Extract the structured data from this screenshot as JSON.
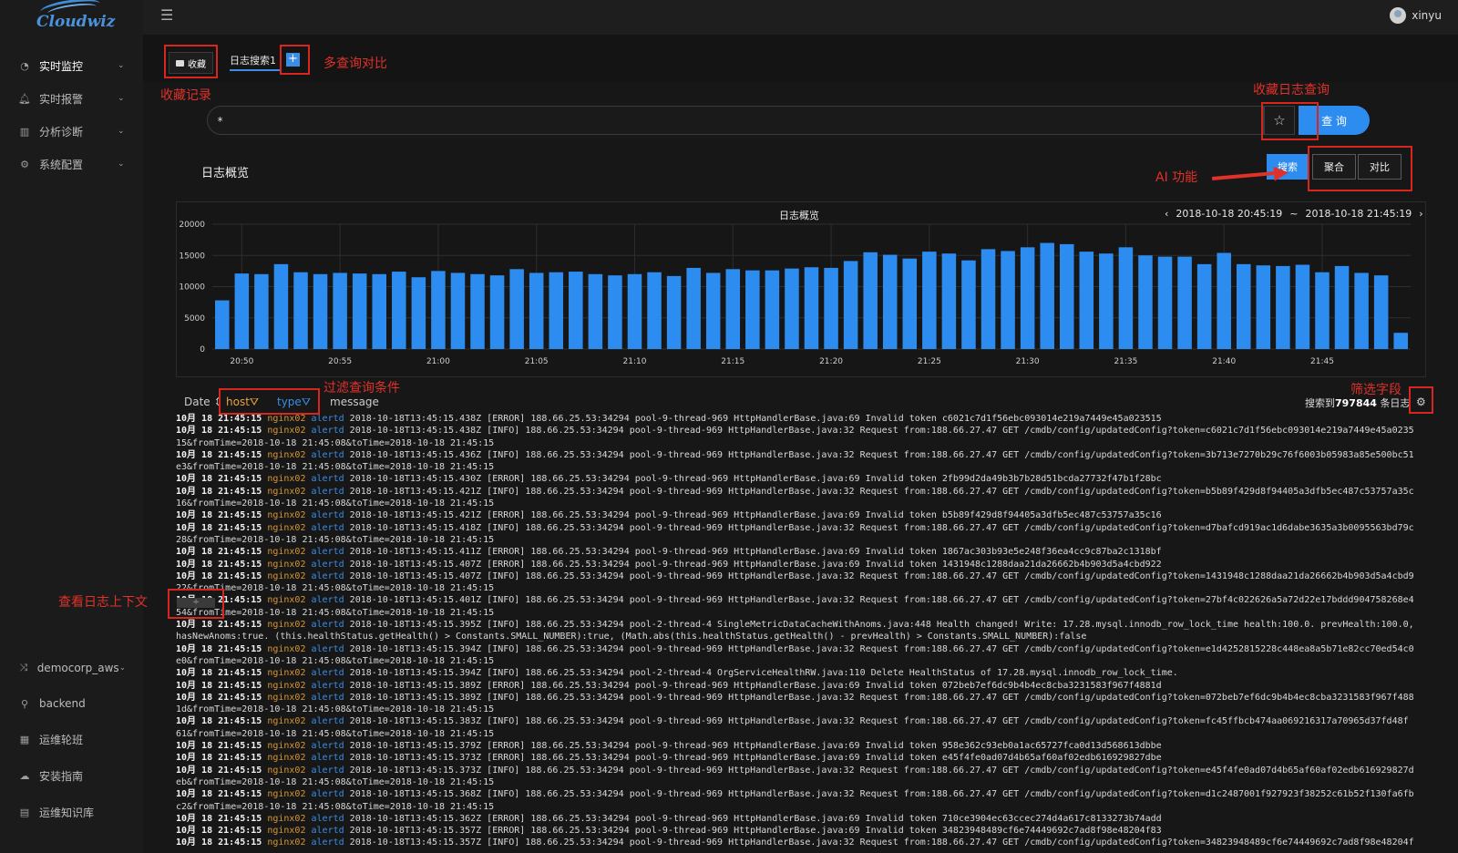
{
  "app": {
    "logo_text": "Cloudwiz",
    "username": "xinyu"
  },
  "sidebar": {
    "items": [
      {
        "label": "实时监控",
        "icon": "dashboard-icon"
      },
      {
        "label": "实时报警",
        "icon": "bell-icon"
      },
      {
        "label": "分析诊断",
        "icon": "bar-chart-icon"
      },
      {
        "label": "系统配置",
        "icon": "gears-icon"
      }
    ],
    "bottom_items": [
      {
        "label": "democorp_aws",
        "icon": "shuffle-icon"
      },
      {
        "label": "backend",
        "icon": "sitemap-icon"
      },
      {
        "label": "运维轮班",
        "icon": "calendar-icon"
      },
      {
        "label": "安装指南",
        "icon": "cloud-icon"
      },
      {
        "label": "运维知识库",
        "icon": "book-icon"
      }
    ]
  },
  "tabs": {
    "favorites_label": "收藏",
    "search_tab_label": "日志搜索1",
    "add_label": "+"
  },
  "search": {
    "value": "*",
    "star_icon": "star-icon",
    "query_label": "查 询"
  },
  "overview": {
    "title": "日志概览",
    "modes": [
      "搜索",
      "聚合",
      "对比"
    ]
  },
  "annotations": {
    "multi_query": "多查询对比",
    "favorites_record": "收藏记录",
    "save_query": "收藏日志查询",
    "ai_function": "AI 功能",
    "filter_conditions": "过滤查询条件",
    "filter_fields": "筛选字段",
    "view_context": "查看日志上下文"
  },
  "chart_data": {
    "type": "bar",
    "title": "日志概览",
    "range_start": "2018-10-18 20:45:19",
    "range_sep": "~",
    "range_end": "2018-10-18 21:45:19",
    "ylim": [
      0,
      20000
    ],
    "yticks": [
      "20000",
      "15000",
      "10000",
      "5000",
      "0"
    ],
    "xticks": [
      "20:50",
      "20:55",
      "21:00",
      "21:05",
      "21:10",
      "21:15",
      "21:20",
      "21:25",
      "21:30",
      "21:35",
      "21:40",
      "21:45"
    ],
    "bar_color": "#2d8cf0",
    "values": [
      7800,
      12100,
      12000,
      13600,
      12300,
      12000,
      12200,
      12100,
      12000,
      12400,
      11500,
      12500,
      12200,
      12000,
      11800,
      12800,
      12200,
      12300,
      12400,
      12000,
      11800,
      12000,
      12300,
      11700,
      13000,
      12200,
      12800,
      12600,
      12600,
      12900,
      13100,
      13000,
      14100,
      15500,
      15100,
      14500,
      15600,
      15300,
      14200,
      16000,
      15700,
      16300,
      17000,
      16800,
      15600,
      15300,
      16300,
      15000,
      14800,
      14800,
      13600,
      15400,
      13600,
      13400,
      13300,
      13500,
      12300,
      13300,
      12200,
      11800,
      2600
    ]
  },
  "table": {
    "headers": {
      "date": "Date ⇕",
      "host": "host",
      "type": "type",
      "message": "message"
    },
    "result_prefix": "搜索到",
    "result_count": "797844",
    "result_suffix": "条日志",
    "context_btn": "÷",
    "rows": [
      {
        "date": "10月 18 21:45:15",
        "host": "nginx02",
        "type": "alertd",
        "msg": "2018-10-18T13:45:15.438Z [ERROR] 188.66.25.53:34294 pool-9-thread-969 HttpHandlerBase.java:69  Invalid token c6021c7d1f56ebc093014e219a7449e45a023515"
      },
      {
        "date": "10月 18 21:45:15",
        "host": "nginx02",
        "type": "alertd",
        "msg": "2018-10-18T13:45:15.438Z [INFO] 188.66.25.53:34294 pool-9-thread-969 HttpHandlerBase.java:32  Request from:188.66.27.47 GET /cmdb/config/updatedConfig?token=c6021c7d1f56ebc093014e219a7449e45a0235",
        "cont": "15&fromTime=2018-10-18 21:45:08&toTime=2018-10-18 21:45:15"
      },
      {
        "date": "10月 18 21:45:15",
        "host": "nginx02",
        "type": "alertd",
        "msg": "2018-10-18T13:45:15.436Z [INFO] 188.66.25.53:34294 pool-9-thread-969 HttpHandlerBase.java:32  Request from:188.66.27.47 GET /cmdb/config/updatedConfig?token=3b713e7270b29c76f6003b05983a85e500bc51",
        "cont": "e3&fromTime=2018-10-18 21:45:08&toTime=2018-10-18 21:45:15"
      },
      {
        "date": "10月 18 21:45:15",
        "host": "nginx02",
        "type": "alertd",
        "msg": "2018-10-18T13:45:15.430Z [ERROR] 188.66.25.53:34294 pool-9-thread-969 HttpHandlerBase.java:69  Invalid token 2fb99d2da49b3b7b28d51bcda27732f47b1f28bc"
      },
      {
        "date": "10月 18 21:45:15",
        "host": "nginx02",
        "type": "alertd",
        "msg": "2018-10-18T13:45:15.421Z [INFO] 188.66.25.53:34294 pool-9-thread-969 HttpHandlerBase.java:32  Request from:188.66.27.47 GET /cmdb/config/updatedConfig?token=b5b89f429d8f94405a3dfb5ec487c53757a35c",
        "cont": "16&fromTime=2018-10-18 21:45:08&toTime=2018-10-18 21:45:15"
      },
      {
        "date": "10月 18 21:45:15",
        "host": "nginx02",
        "type": "alertd",
        "msg": "2018-10-18T13:45:15.421Z [ERROR] 188.66.25.53:34294 pool-9-thread-969 HttpHandlerBase.java:69  Invalid token b5b89f429d8f94405a3dfb5ec487c53757a35c16"
      },
      {
        "date": "10月 18 21:45:15",
        "host": "nginx02",
        "type": "alertd",
        "msg": "2018-10-18T13:45:15.418Z [INFO] 188.66.25.53:34294 pool-9-thread-969 HttpHandlerBase.java:32  Request from:188.66.27.47 GET /cmdb/config/updatedConfig?token=d7bafcd919ac1d6dabe3635a3b0095563bd79c",
        "cont": "28&fromTime=2018-10-18 21:45:08&toTime=2018-10-18 21:45:15"
      },
      {
        "date": "10月 18 21:45:15",
        "host": "nginx02",
        "type": "alertd",
        "msg": "2018-10-18T13:45:15.411Z [ERROR] 188.66.25.53:34294 pool-9-thread-969 HttpHandlerBase.java:69  Invalid token 1867ac303b93e5e248f36ea4cc9c87ba2c1318bf"
      },
      {
        "date": "10月 18 21:45:15",
        "host": "nginx02",
        "type": "alertd",
        "msg": "2018-10-18T13:45:15.407Z [ERROR] 188.66.25.53:34294 pool-9-thread-969 HttpHandlerBase.java:69  Invalid token 1431948c1288daa21da26662b4b903d5a4cbd922"
      },
      {
        "date": "10月 18 21:45:15",
        "host": "nginx02",
        "type": "alertd",
        "msg": "2018-10-18T13:45:15.407Z [INFO] 188.66.25.53:34294 pool-9-thread-969 HttpHandlerBase.java:32  Request from:188.66.27.47 GET /cmdb/config/updatedConfig?token=1431948c1288daa21da26662b4b903d5a4cbd9",
        "cont": "22&fromTime=2018-10-18 21:45:08&toTime=2018-10-18 21:45:15"
      },
      {
        "date": "10月 18 21:45:15",
        "host": "nginx02",
        "type": "alertd",
        "msg": "2018-10-18T13:45:15.401Z [INFO] 188.66.25.53:34294 pool-9-thread-969 HttpHandlerBase.java:32  Request from:188.66.27.47 GET /cmdb/config/updatedConfig?token=27bf4c022626a5a72d22e17bddd904758268e4",
        "cont": "54&fromTime=2018-10-18 21:45:08&toTime=2018-10-18 21:45:15"
      },
      {
        "date": "10月 18 21:45:15",
        "host": "nginx02",
        "type": "alertd",
        "msg": "2018-10-18T13:45:15.395Z [INFO] 188.66.25.53:34294 pool-2-thread-4 SingleMetricDataCacheWithAnoms.java:448  Health changed! Write: 17.28.mysql.innodb_row_lock_time health:100.0. prevHealth:100.0,",
        "cont": "hasNewAnoms:true. (this.healthStatus.getHealth() > Constants.SMALL_NUMBER):true, (Math.abs(this.healthStatus.getHealth() - prevHealth) > Constants.SMALL_NUMBER):false"
      },
      {
        "date": "10月 18 21:45:15",
        "host": "nginx02",
        "type": "alertd",
        "msg": "2018-10-18T13:45:15.394Z [INFO] 188.66.25.53:34294 pool-9-thread-969 HttpHandlerBase.java:32  Request from:188.66.27.47 GET /cmdb/config/updatedConfig?token=e1d4252815228c448ea8a5b71e82cc70ed54c0",
        "cont": "e0&fromTime=2018-10-18 21:45:08&toTime=2018-10-18 21:45:15"
      },
      {
        "date": "10月 18 21:45:15",
        "host": "nginx02",
        "type": "alertd",
        "msg": "2018-10-18T13:45:15.394Z [INFO] 188.66.25.53:34294 pool-2-thread-4 OrgServiceHealthRW.java:110  Delete HealthStatus of 17.28.mysql.innodb_row_lock_time."
      },
      {
        "date": "10月 18 21:45:15",
        "host": "nginx02",
        "type": "alertd",
        "msg": "2018-10-18T13:45:15.389Z [ERROR] 188.66.25.53:34294 pool-9-thread-969 HttpHandlerBase.java:69  Invalid token 072beb7ef6dc9b4b4ec8cba3231583f967f4881d"
      },
      {
        "date": "10月 18 21:45:15",
        "host": "nginx02",
        "type": "alertd",
        "msg": "2018-10-18T13:45:15.389Z [INFO] 188.66.25.53:34294 pool-9-thread-969 HttpHandlerBase.java:32  Request from:188.66.27.47 GET /cmdb/config/updatedConfig?token=072beb7ef6dc9b4b4ec8cba3231583f967f488",
        "cont": "1d&fromTime=2018-10-18 21:45:08&toTime=2018-10-18 21:45:15"
      },
      {
        "date": "10月 18 21:45:15",
        "host": "nginx02",
        "type": "alertd",
        "msg": "2018-10-18T13:45:15.383Z [INFO] 188.66.25.53:34294 pool-9-thread-969 HttpHandlerBase.java:32  Request from:188.66.27.47 GET /cmdb/config/updatedConfig?token=fc45ffbcb474aa069216317a70965d37fd48f",
        "cont": "61&fromTime=2018-10-18 21:45:08&toTime=2018-10-18 21:45:15"
      },
      {
        "date": "10月 18 21:45:15",
        "host": "nginx02",
        "type": "alertd",
        "msg": "2018-10-18T13:45:15.379Z [ERROR] 188.66.25.53:34294 pool-9-thread-969 HttpHandlerBase.java:69  Invalid token 958e362c93eb0a1ac65727fca0d13d568613dbbe"
      },
      {
        "date": "10月 18 21:45:15",
        "host": "nginx02",
        "type": "alertd",
        "msg": "2018-10-18T13:45:15.373Z [ERROR] 188.66.25.53:34294 pool-9-thread-969 HttpHandlerBase.java:69  Invalid token e45f4fe0ad07d4b65af60af02edb616929827dbe"
      },
      {
        "date": "10月 18 21:45:15",
        "host": "nginx02",
        "type": "alertd",
        "msg": "2018-10-18T13:45:15.373Z [INFO] 188.66.25.53:34294 pool-9-thread-969 HttpHandlerBase.java:32  Request from:188.66.27.47 GET /cmdb/config/updatedConfig?token=e45f4fe0ad07d4b65af60af02edb616929827d",
        "cont": "eb&fromTime=2018-10-18 21:45:08&toTime=2018-10-18 21:45:15"
      },
      {
        "date": "10月 18 21:45:15",
        "host": "nginx02",
        "type": "alertd",
        "msg": "2018-10-18T13:45:15.368Z [INFO] 188.66.25.53:34294 pool-9-thread-969 HttpHandlerBase.java:32  Request from:188.66.27.47 GET /cmdb/config/updatedConfig?token=d1c2487001f927923f38252c61b52f130fa6fb",
        "cont": "c2&fromTime=2018-10-18 21:45:08&toTime=2018-10-18 21:45:15"
      },
      {
        "date": "10月 18 21:45:15",
        "host": "nginx02",
        "type": "alertd",
        "msg": "2018-10-18T13:45:15.362Z [ERROR] 188.66.25.53:34294 pool-9-thread-969 HttpHandlerBase.java:69  Invalid token 710ce3904ec63ccec274d4a617c8133273b74add"
      },
      {
        "date": "10月 18 21:45:15",
        "host": "nginx02",
        "type": "alertd",
        "msg": "2018-10-18T13:45:15.357Z [ERROR] 188.66.25.53:34294 pool-9-thread-969 HttpHandlerBase.java:69  Invalid token 34823948489cf6e74449692c7ad8f98e48204f83"
      },
      {
        "date": "10月 18 21:45:15",
        "host": "nginx02",
        "type": "alertd",
        "msg": "2018-10-18T13:45:15.357Z [INFO] 188.66.25.53:34294 pool-9-thread-969 HttpHandlerBase.java:32  Request from:188.66.27.47 GET /cmdb/config/updatedConfig?token=34823948489cf6e74449692c7ad8f98e48204f"
      }
    ]
  }
}
